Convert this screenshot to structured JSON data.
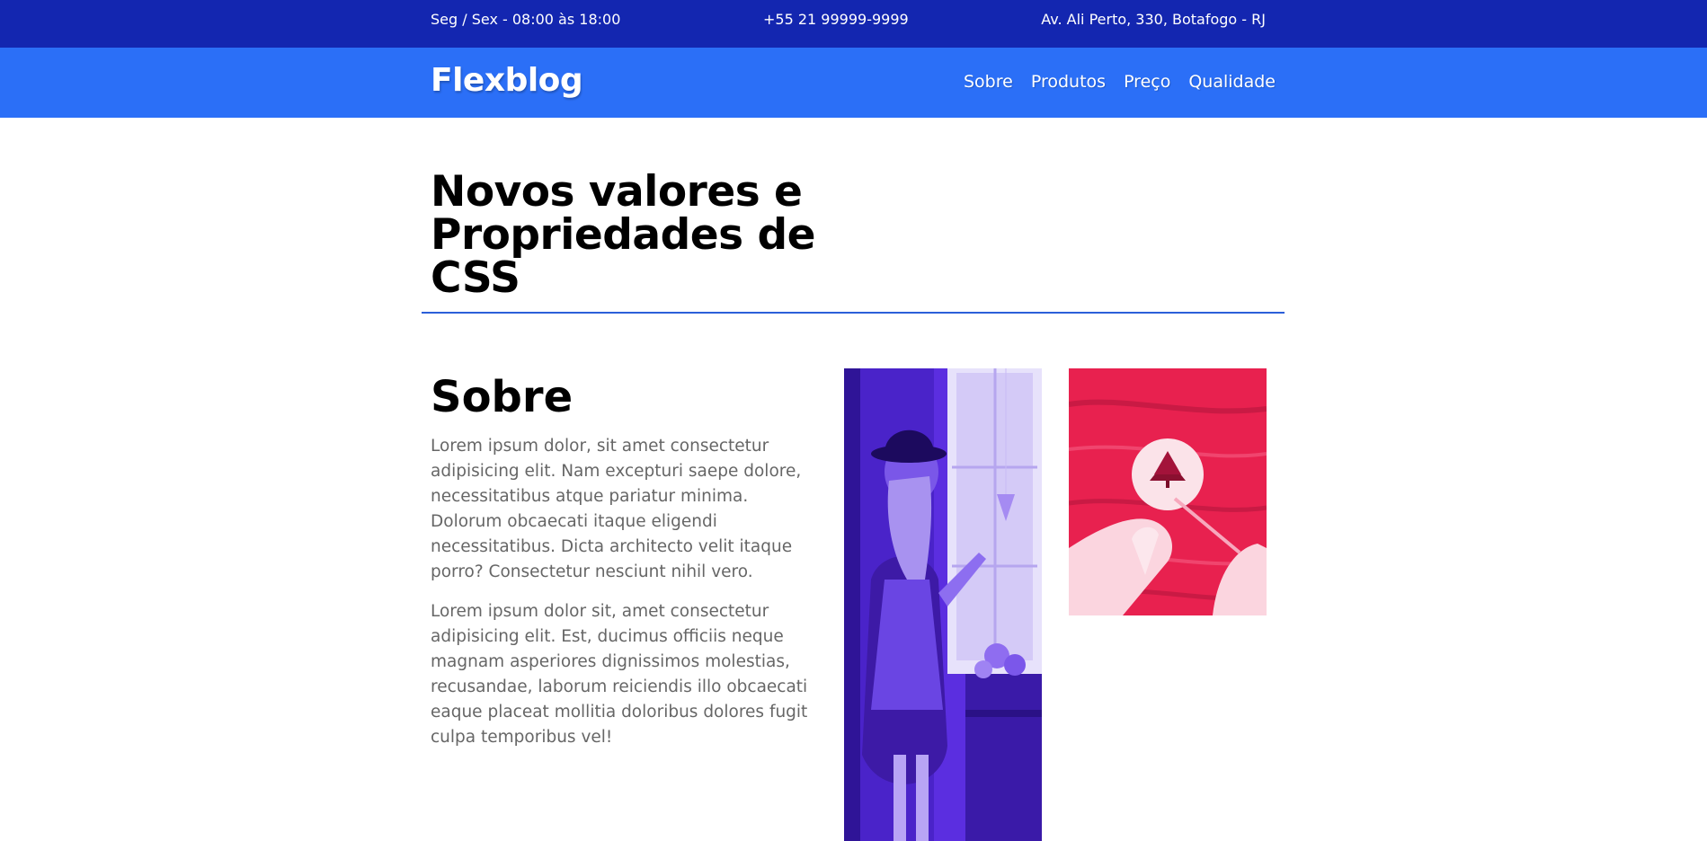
{
  "topbar": {
    "hours": "Seg / Sex - 08:00 às 18:00",
    "phone": "+55 21 99999-9999",
    "address": "Av. Ali Perto, 330, Botafogo - RJ"
  },
  "header": {
    "logo": "Flexblog",
    "nav": [
      "Sobre",
      "Produtos",
      "Preço",
      "Qualidade"
    ]
  },
  "hero": {
    "title_line1": "Novos valores e",
    "title_line2": "Propriedades de CSS"
  },
  "about": {
    "title": "Sobre",
    "paragraphs": [
      "Lorem ipsum dolor, sit amet consectetur adipisicing elit. Nam excepturi saepe dolore, necessitatibus atque pariatur minima. Dolorum obcaecati itaque eligendi necessitatibus. Dicta architecto velit itaque porro? Consectetur nesciunt nihil vero.",
      "Lorem ipsum dolor sit, amet consectetur adipisicing elit. Est, ducimus officiis neque magnam asperiores dignissimos molestias, recusandae, laborum reiciendis illo obcaecati eaque placeat mollitia doloribus dolores fugit culpa temporibus vel!"
    ]
  },
  "colors": {
    "topbar": "#1326b0",
    "navbar": "#2b6ff7",
    "divider": "#2b5fd9",
    "photo_purple": "#5b2ee0",
    "photo_red": "#e8214f"
  },
  "images": {
    "tall": "woman-hat-window-photo",
    "square": "hands-painting-tree-photo"
  }
}
